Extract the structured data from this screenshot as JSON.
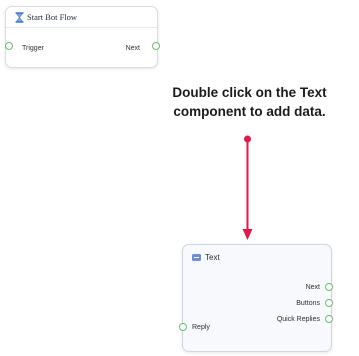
{
  "start_node": {
    "title": "Start Bot Flow",
    "icon": "hourglass-icon",
    "ports": {
      "input": "Trigger",
      "output": "Next"
    }
  },
  "instruction": {
    "line1": "Double click on the Text",
    "line2": "component to add data."
  },
  "text_node": {
    "title": "Text",
    "icon": "text-message-icon",
    "outputs": [
      "Next",
      "Buttons",
      "Quick Replies"
    ],
    "input": "Reply"
  },
  "colors": {
    "port": "#65c16c",
    "arrow": "#e3174f",
    "text_icon": "#6a8de0",
    "hourglass": "#3b6fd8"
  }
}
